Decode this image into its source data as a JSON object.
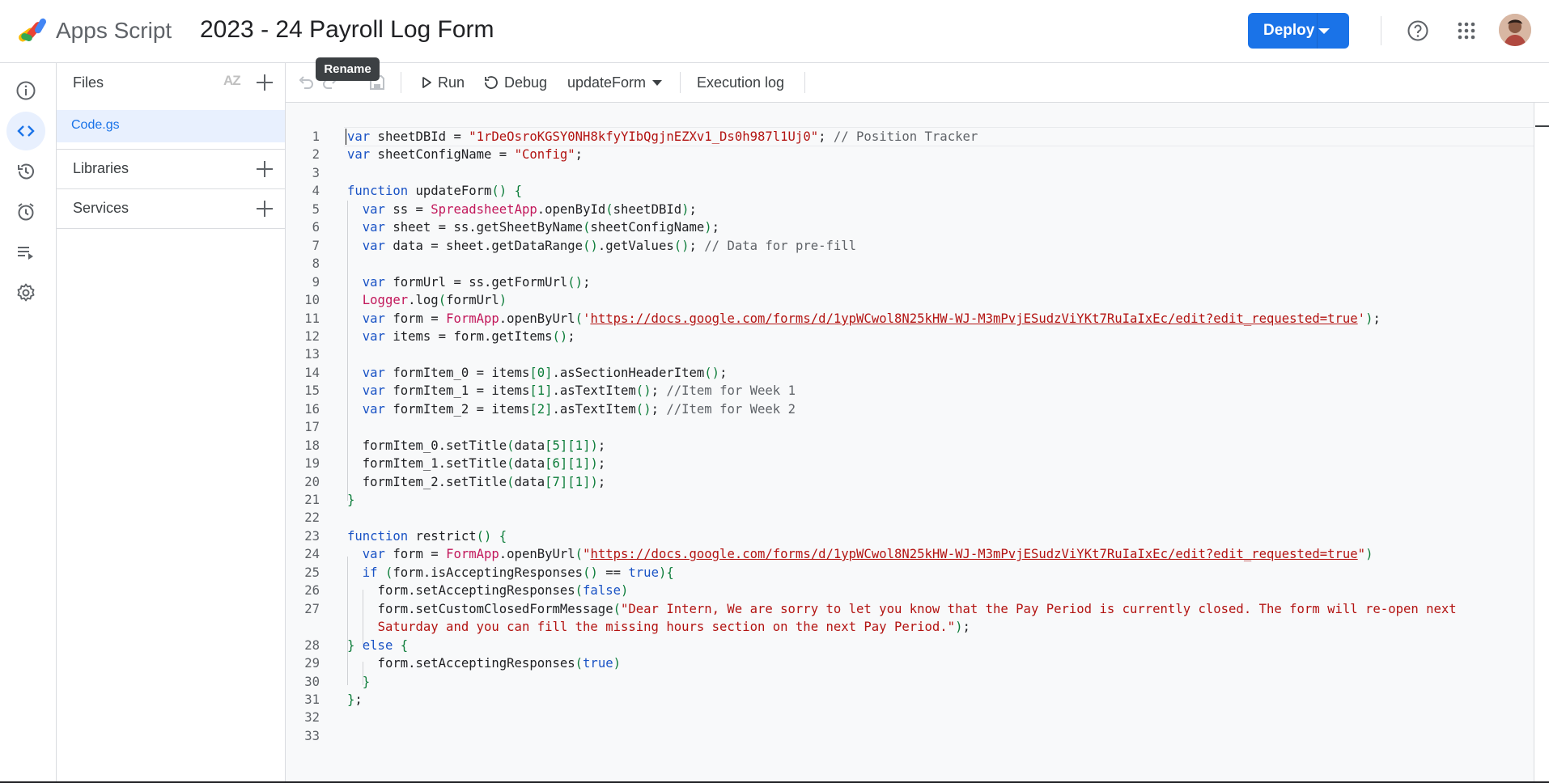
{
  "header": {
    "app_name": "Apps Script",
    "project_title": "2023 - 24 Payroll Log Form",
    "deploy_label": "Deploy",
    "icons": [
      "help-icon",
      "apps-grid-icon",
      "account-avatar"
    ]
  },
  "rail": {
    "items": [
      "overview-icon",
      "editor-icon",
      "history-icon",
      "triggers-icon",
      "executions-icon",
      "settings-icon"
    ],
    "active": "editor-icon"
  },
  "files_panel": {
    "title": "Files",
    "sort_icon": "AZ",
    "files": [
      "Code.gs"
    ],
    "sections": [
      "Libraries",
      "Services"
    ]
  },
  "tooltip": {
    "text": "Rename"
  },
  "toolbar": {
    "run_label": "Run",
    "debug_label": "Debug",
    "function_select": "updateForm",
    "execution_log_label": "Execution log"
  },
  "colors": {
    "accent": "#1a73e8",
    "selected_file_bg": "#e8f0fe",
    "editor_bg": "#f8f9fa"
  },
  "code": {
    "line_numbers": [
      "1",
      "2",
      "3",
      "4",
      "5",
      "6",
      "7",
      "8",
      "9",
      "10",
      "11",
      "12",
      "13",
      "14",
      "15",
      "16",
      "17",
      "18",
      "19",
      "20",
      "21",
      "22",
      "23",
      "24",
      "25",
      "26",
      "27",
      "",
      "28",
      "29",
      "30",
      "31",
      "32",
      "33"
    ],
    "lines": [
      "var sheetDBId = \"1rDeOsroKGSY0NH8kfyYIbQgjnEZXv1_Ds0h987l1Uj0\"; // Position Tracker",
      "var sheetConfigName = \"Config\";",
      "",
      "function updateForm() {",
      "  var ss = SpreadsheetApp.openById(sheetDBId);",
      "  var sheet = ss.getSheetByName(sheetConfigName);",
      "  var data = sheet.getDataRange().getValues(); // Data for pre-fill",
      "",
      "  var formUrl = ss.getFormUrl();",
      "  Logger.log(formUrl)",
      "  var form = FormApp.openByUrl('https://docs.google.com/forms/d/1ypWCwol8N25kHW-WJ-M3mPvjESudzViYKt7RuIaIxEc/edit?edit_requested=true');",
      "  var items = form.getItems();",
      "",
      "  var formItem_0 = items[0].asSectionHeaderItem();",
      "  var formItem_1 = items[1].asTextItem(); //Item for Week 1",
      "  var formItem_2 = items[2].asTextItem(); //Item for Week 2",
      "",
      "  formItem_0.setTitle(data[5][1]);",
      "  formItem_1.setTitle(data[6][1]);",
      "  formItem_2.setTitle(data[7][1]);",
      "}",
      "",
      "function restrict() {",
      "  var form = FormApp.openByUrl(\"https://docs.google.com/forms/d/1ypWCwol8N25kHW-WJ-M3mPvjESudzViYKt7RuIaIxEc/edit?edit_requested=true\")",
      "  if (form.isAcceptingResponses() == true){",
      "    form.setAcceptingResponses(false)",
      "    form.setCustomClosedFormMessage(\"Dear Intern, We are sorry to let you know that the Pay Period is currently closed. The form will re-open next",
      "    Saturday and you can fill the missing hours section on the next Pay Period.\");",
      "} else {",
      "    form.setAcceptingResponses(true)",
      "  }",
      "};",
      "",
      ""
    ]
  }
}
